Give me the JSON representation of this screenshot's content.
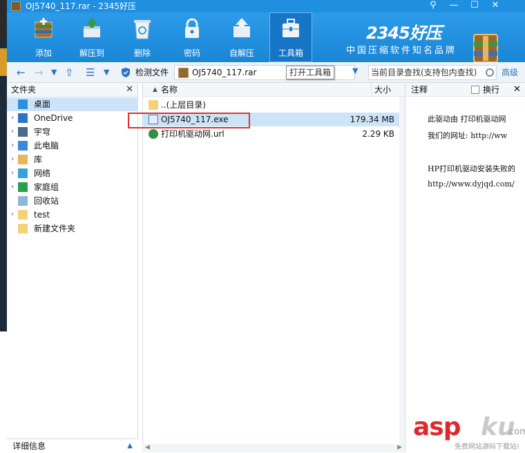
{
  "window": {
    "title": "OJ5740_117.rar - 2345好压",
    "controls": [
      "⚲",
      "—",
      "☐",
      "✕"
    ]
  },
  "toolbar": {
    "items": [
      {
        "label": "添加",
        "icon": "add-archive-icon"
      },
      {
        "label": "解压到",
        "icon": "extract-to-icon"
      },
      {
        "label": "删除",
        "icon": "recycle-delete-icon"
      },
      {
        "label": "密码",
        "icon": "lock-icon"
      },
      {
        "label": "自解压",
        "icon": "self-extract-icon"
      },
      {
        "label": "工具箱",
        "icon": "toolbox-icon",
        "active": true
      }
    ]
  },
  "brand": {
    "name": "2345好压",
    "slogan": "中国压缩软件知名品牌"
  },
  "nav": {
    "detect_label": "检测文件",
    "path": "OJ5740_117.rar",
    "tooltip": "打开工具箱",
    "search_placeholder": "当前目录查找(支持包内查找)",
    "advanced": "高级"
  },
  "left_panel": {
    "header": "文件夹",
    "close": "✕",
    "items": [
      {
        "label": "桌面",
        "icon": "desktop-icon",
        "selected": true,
        "arrow": ""
      },
      {
        "label": "OneDrive",
        "icon": "cloud-icon",
        "selected": false,
        "arrow": "›"
      },
      {
        "label": "宇穹",
        "icon": "user-icon",
        "selected": false,
        "arrow": "›"
      },
      {
        "label": "此电脑",
        "icon": "computer-icon",
        "selected": false,
        "arrow": "›"
      },
      {
        "label": "库",
        "icon": "library-icon",
        "selected": false,
        "arrow": "›"
      },
      {
        "label": "网络",
        "icon": "network-icon",
        "selected": false,
        "arrow": "›"
      },
      {
        "label": "家庭组",
        "icon": "homegroup-icon",
        "selected": false,
        "arrow": "›"
      },
      {
        "label": "回收站",
        "icon": "recycle-bin-icon",
        "selected": false,
        "arrow": ""
      },
      {
        "label": "test",
        "icon": "folder-icon",
        "selected": false,
        "arrow": "›"
      },
      {
        "label": "新建文件夹",
        "icon": "folder-icon",
        "selected": false,
        "arrow": ""
      }
    ],
    "footer": "详细信息"
  },
  "file_list": {
    "col_name": "名称",
    "col_size": "大小",
    "files": [
      {
        "name": "..(上层目录)",
        "size": "",
        "icon": "folder-up-icon"
      },
      {
        "name": "OJ5740_117.exe",
        "size": "179.34 MB",
        "icon": "exe-icon"
      },
      {
        "name": "打印机驱动网.url",
        "size": "2.29 KB",
        "icon": "url-globe-icon"
      }
    ]
  },
  "comment_panel": {
    "header": "注释",
    "wrap_label": "换行",
    "close": "✕",
    "lines": [
      "此驱动由 打印机驱动网",
      "我们的网址: http://ww",
      "",
      "HP打印机驱动安装失败的",
      "http://www.dyjqd.com/"
    ]
  },
  "watermark": {
    "main_red": "asp",
    "main_gray": "ku",
    "domain_tail": ".com",
    "sub": "免费网站源码下载站!"
  }
}
